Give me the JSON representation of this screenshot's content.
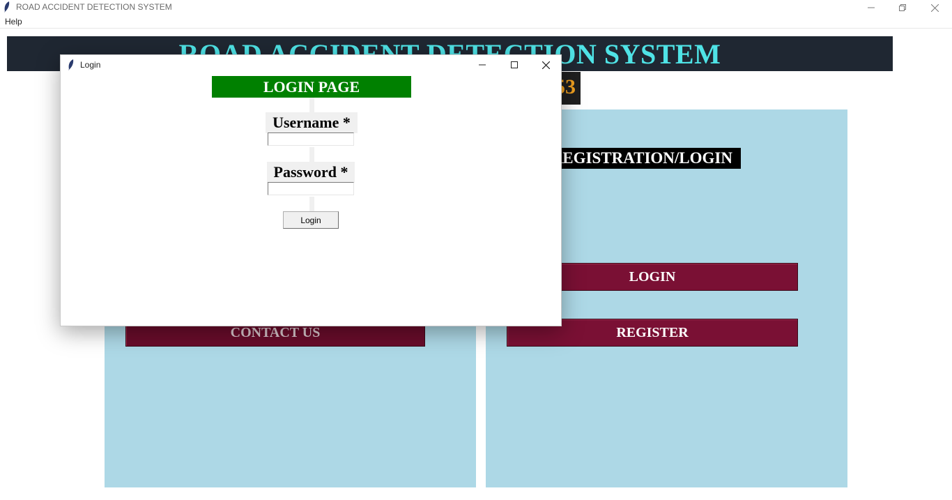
{
  "window": {
    "title": "ROAD ACCIDENT DETECTION SYSTEM",
    "menu": [
      "Help"
    ]
  },
  "header": {
    "title": "ROAD ACCIDENT DETECTION SYSTEM",
    "clock_fragment": "53"
  },
  "right_panel": {
    "label": "REGISTRATION/LOGIN",
    "login_button": "LOGIN",
    "register_button": "REGISTER"
  },
  "left_panel": {
    "contact_button": "CONTACT US"
  },
  "dialog": {
    "title": "Login",
    "heading": "LOGIN PAGE",
    "username_label": "Username *",
    "username_value": "",
    "password_label": "Password *",
    "password_value": "",
    "submit_label": "Login"
  },
  "colors": {
    "header_bg": "#1f2732",
    "header_text": "#4fe3e6",
    "panel_bg": "#add8e6",
    "button_bg": "#7a1034",
    "login_header_bg": "#008000",
    "clock_text": "#f0a020"
  }
}
